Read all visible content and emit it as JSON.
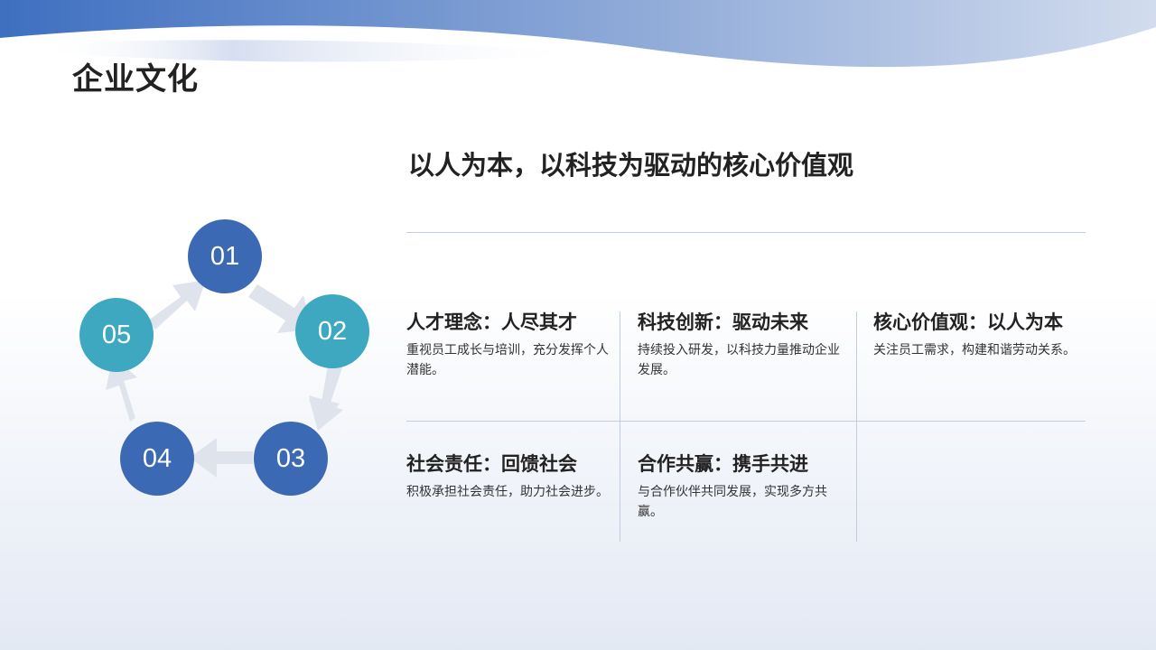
{
  "page": {
    "title": "企业文化",
    "subtitle": "以人为本，以科技为驱动的核心价值观"
  },
  "colors": {
    "wave_dark": "#3e6fc0",
    "node_dark_blue": "#3c69b4",
    "node_teal": "#3ea8c1",
    "arrow_gray": "#dfe3ec",
    "divider": "#c3cde0"
  },
  "cycle": {
    "nodes": [
      {
        "label": "01",
        "color": "#3c69b4"
      },
      {
        "label": "02",
        "color": "#3ea8c1"
      },
      {
        "label": "03",
        "color": "#3c69b4"
      },
      {
        "label": "04",
        "color": "#3c69b4"
      },
      {
        "label": "05",
        "color": "#3ea8c1"
      }
    ]
  },
  "cells": [
    {
      "title": "人才理念：人尽其才",
      "desc": "重视员工成长与培训，充分发挥个人潜能。"
    },
    {
      "title": "科技创新：驱动未来",
      "desc": "持续投入研发，以科技力量推动企业发展。"
    },
    {
      "title": "核心价值观：以人为本",
      "desc": "关注员工需求，构建和谐劳动关系。"
    },
    {
      "title": "社会责任：回馈社会",
      "desc": "积极承担社会责任，助力社会进步。"
    },
    {
      "title": "合作共赢：携手共进",
      "desc": "与合作伙伴共同发展，实现多方共赢。"
    }
  ]
}
